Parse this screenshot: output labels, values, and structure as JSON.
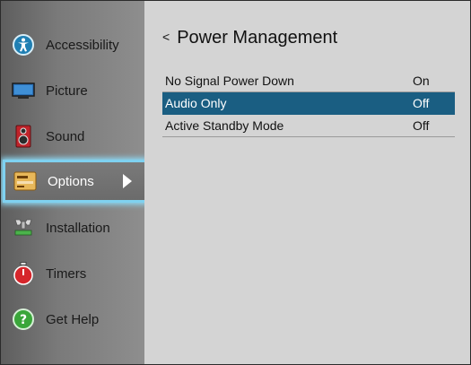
{
  "sidebar": {
    "items": [
      {
        "label": "Accessibility",
        "icon": "accessibility-icon"
      },
      {
        "label": "Picture",
        "icon": "picture-icon"
      },
      {
        "label": "Sound",
        "icon": "sound-icon"
      },
      {
        "label": "Options",
        "icon": "options-icon",
        "selected": true
      },
      {
        "label": "Installation",
        "icon": "installation-icon"
      },
      {
        "label": "Timers",
        "icon": "timers-icon"
      },
      {
        "label": "Get Help",
        "icon": "help-icon"
      }
    ]
  },
  "main": {
    "back_symbol": "<",
    "title": "Power Management",
    "rows": [
      {
        "name": "No Signal Power Down",
        "value": "On"
      },
      {
        "name": "Audio Only",
        "value": "Off",
        "selected": true
      },
      {
        "name": "Active Standby Mode",
        "value": "Off"
      }
    ]
  },
  "colors": {
    "selection_blue": "#1a5e82",
    "focus_glow": "#7fd1f0"
  }
}
